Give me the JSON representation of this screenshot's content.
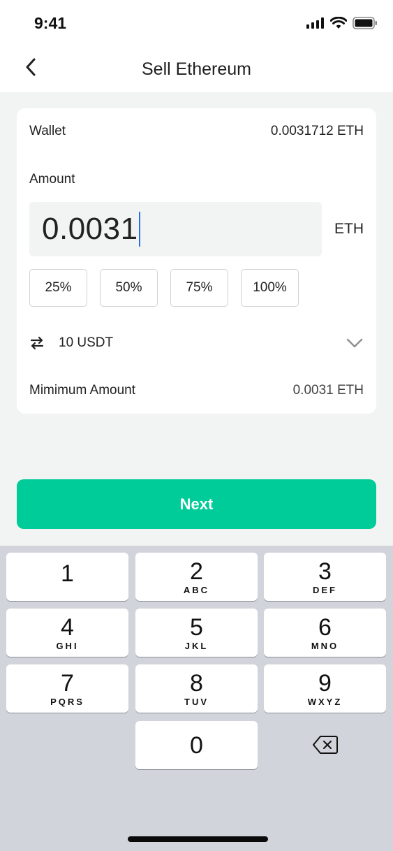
{
  "status_bar": {
    "time": "9:41",
    "icons": [
      "cellular-signal-icon",
      "wifi-icon",
      "battery-icon"
    ]
  },
  "nav": {
    "title": "Sell Ethereum",
    "back_icon": "chevron-left-icon"
  },
  "wallet": {
    "label": "Wallet",
    "balance": "0.0031712 ETH"
  },
  "amount": {
    "label": "Amount",
    "value": "0.0031",
    "unit": "ETH"
  },
  "percent_options": [
    "25%",
    "50%",
    "75%",
    "100%"
  ],
  "conversion": {
    "icon": "swap-arrows-icon",
    "text": "10 USDT",
    "dropdown_icon": "chevron-down-icon"
  },
  "minimum": {
    "label": "Mimimum Amount",
    "value": "0.0031 ETH"
  },
  "next_button": {
    "label": "Next"
  },
  "keyboard": {
    "keys": [
      {
        "digit": "1",
        "letters": ""
      },
      {
        "digit": "2",
        "letters": "ABC"
      },
      {
        "digit": "3",
        "letters": "DEF"
      },
      {
        "digit": "4",
        "letters": "GHI"
      },
      {
        "digit": "5",
        "letters": "JKL"
      },
      {
        "digit": "6",
        "letters": "MNO"
      },
      {
        "digit": "7",
        "letters": "PQRS"
      },
      {
        "digit": "8",
        "letters": "TUV"
      },
      {
        "digit": "9",
        "letters": "WXYZ"
      },
      {
        "digit": "0",
        "letters": ""
      }
    ],
    "delete_icon": "backspace-icon"
  },
  "colors": {
    "accent": "#00CC99",
    "background": "#F2F4F3",
    "keyboard_bg": "#D1D4DA",
    "caret": "#2F6FE6"
  }
}
